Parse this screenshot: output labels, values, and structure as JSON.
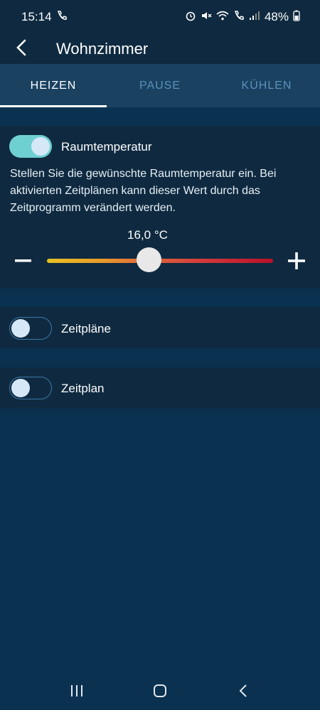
{
  "status_bar": {
    "time": "15:14",
    "battery": "48%",
    "icons": [
      "call-icon",
      "alarm-icon",
      "mute-icon",
      "wifi-icon",
      "wifi-call-icon",
      "signal-icon",
      "battery-icon"
    ]
  },
  "header": {
    "title": "Wohnzimmer",
    "back_icon": "back-arrow-icon"
  },
  "tabs": [
    {
      "label": "HEIZEN",
      "active": true
    },
    {
      "label": "PAUSE",
      "active": false
    },
    {
      "label": "KÜHLEN",
      "active": false
    }
  ],
  "room_temperature": {
    "label": "Raumtemperatur",
    "enabled": true,
    "description": "Stellen Sie die gewünschte Raumtemperatur ein. Bei aktivierten Zeitplänen kann dieser Wert durch das Zeitprogramm verändert werden.",
    "value": "16,0 °C",
    "slider_fraction": 0.45,
    "minus_label": "–",
    "plus_label": "+"
  },
  "schedules": {
    "label": "Zeitpläne",
    "enabled": false
  },
  "schedule": {
    "label": "Zeitplan",
    "enabled": false
  },
  "colors": {
    "background": "#0b3150",
    "panel": "#0f2a40",
    "tab_bar": "#1a4260",
    "toggle_on": "#6fd0d2",
    "tab_inactive": "#5c90bb"
  }
}
